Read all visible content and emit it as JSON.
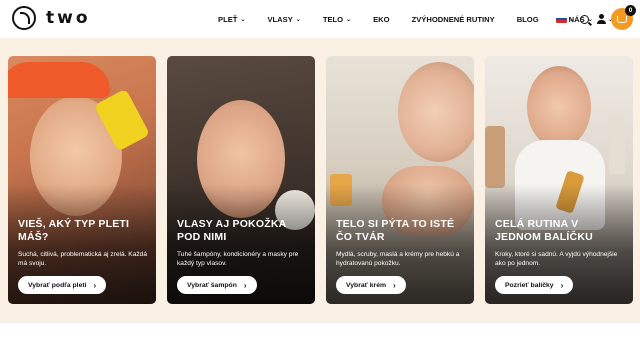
{
  "brand": {
    "logo_text": "two",
    "logo_icon": "logo-2-circle-icon"
  },
  "nav": {
    "items": [
      {
        "label": "PLEŤ",
        "has_dropdown": true
      },
      {
        "label": "VLASY",
        "has_dropdown": true
      },
      {
        "label": "TELO",
        "has_dropdown": true
      },
      {
        "label": "EKO",
        "has_dropdown": false
      },
      {
        "label": "ZVÝHODNENÉ RUTINY",
        "has_dropdown": false
      },
      {
        "label": "BLOG",
        "has_dropdown": false
      },
      {
        "label": "O NÁS",
        "has_dropdown": true
      }
    ],
    "dropdown_glyph": "⌄"
  },
  "header_icons": {
    "flag": "slovak-flag-icon",
    "search": "search-icon",
    "user": "user-icon",
    "cart": "cart-icon",
    "cart_count": "0",
    "cart_color": "#f39a22"
  },
  "hero": {
    "background": "#fbf0e4",
    "cards": [
      {
        "title": "VIEŠ, AKÝ TYP PLETI MÁŠ?",
        "description": "Suchá, citlivá, problematická aj zrelá. Každá má svoju.",
        "button": "Vybrať podľa pleti",
        "arrow": "›"
      },
      {
        "title": "VLASY AJ POKOŽKA POD NIMI",
        "description": "Tuhé šampóny, kondicionéry a masky pre každý typ vlasov.",
        "button": "Vybrať šampón",
        "arrow": "›"
      },
      {
        "title": "TELO SI PÝTA TO ISTÉ ČO TVÁR",
        "description": "Mydlá, scruby, maslá a krémy pre hebkú a hydratovanú pokožku.",
        "button": "Vybrať krém",
        "arrow": "›"
      },
      {
        "title": "CELÁ RUTINA V JEDNOM BALÍČKU",
        "description": "Kroky, ktoré si sadnú. A vyjdú výhodnejšie ako po jednom.",
        "button": "Pozrieť balíčky",
        "arrow": "›"
      }
    ]
  }
}
